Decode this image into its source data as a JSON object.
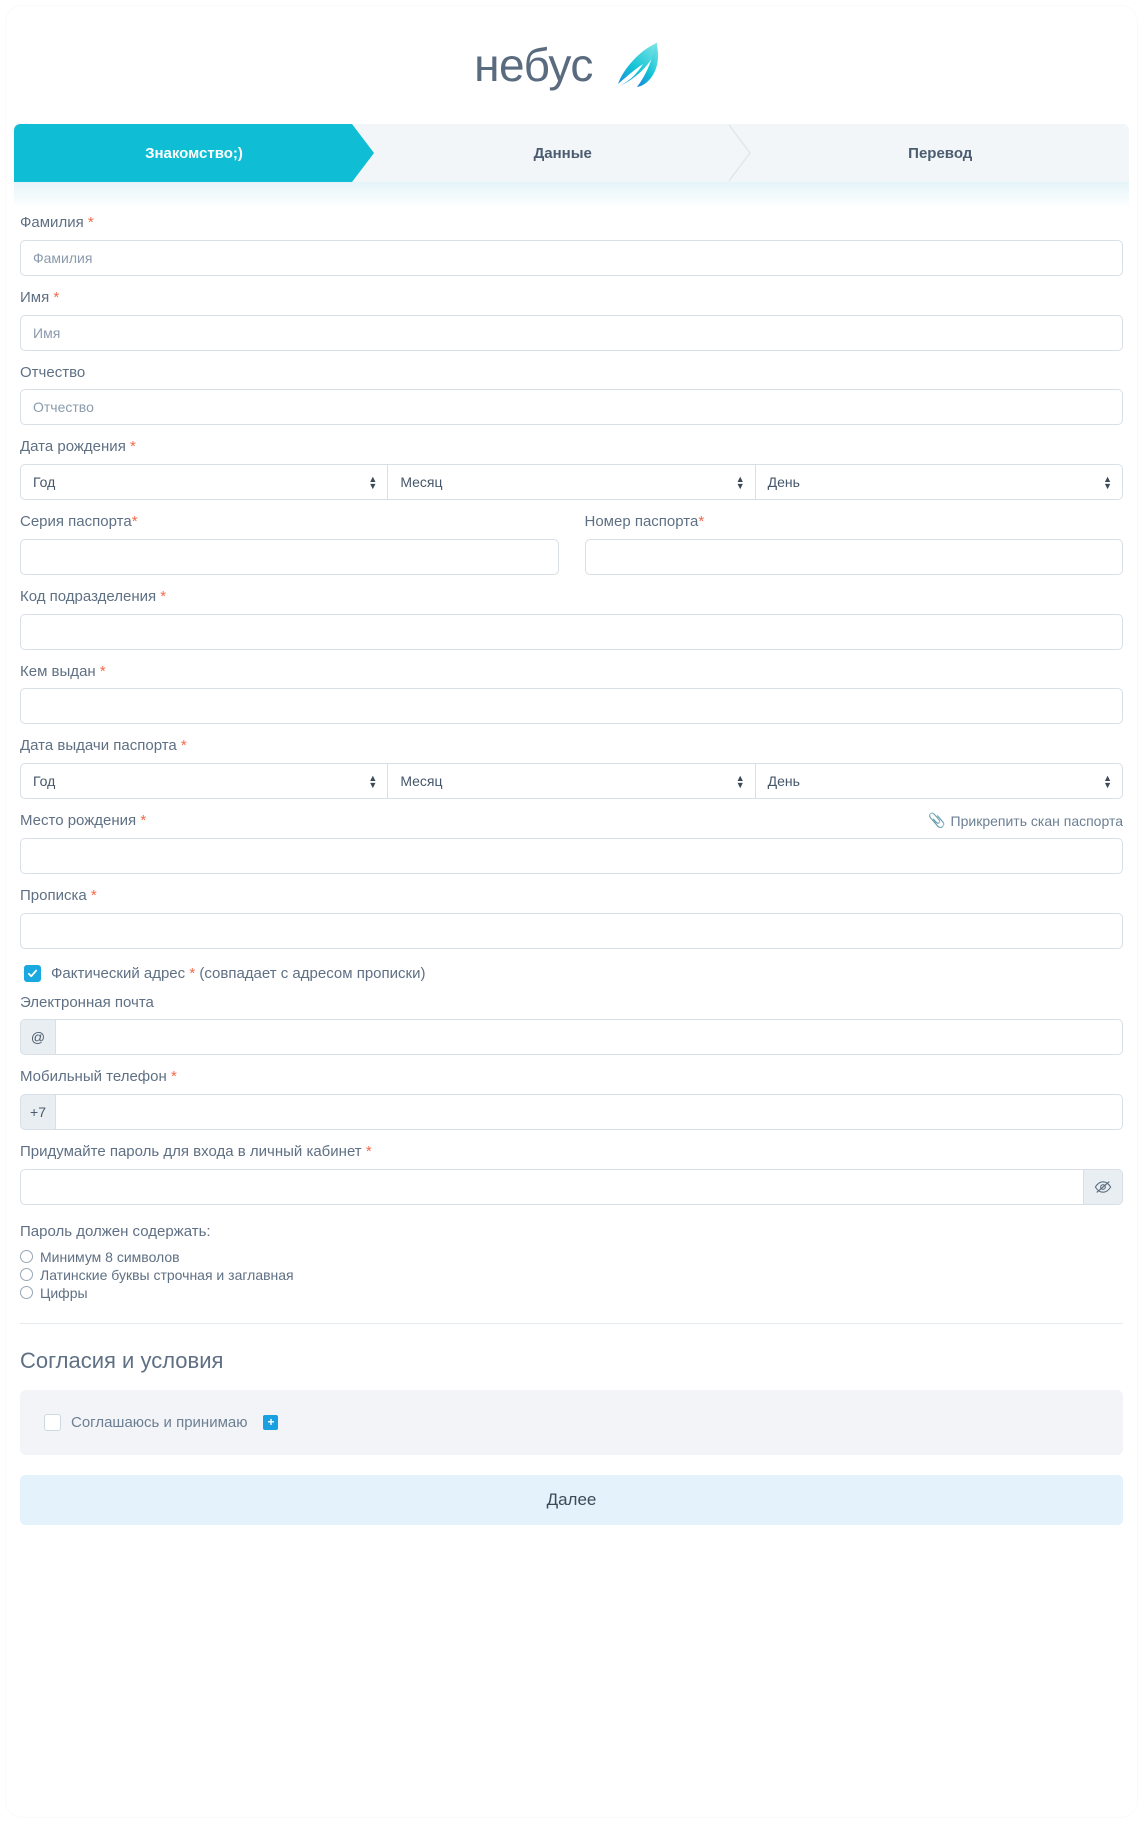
{
  "brand": {
    "name": "небус",
    "logo_icon": "swoosh-mark-icon",
    "text_color": "#5a6b80",
    "accent": "#0fbdd4"
  },
  "stepper": {
    "steps": [
      {
        "label": "Знакомство;)",
        "active": true
      },
      {
        "label": "Данные",
        "active": false
      },
      {
        "label": "Перевод",
        "active": false
      }
    ]
  },
  "form": {
    "last_name": {
      "label": "Фамилия",
      "required_mark": "*",
      "placeholder": "Фамилия",
      "value": ""
    },
    "first_name": {
      "label": "Имя",
      "required_mark": "*",
      "placeholder": "Имя",
      "value": ""
    },
    "middle_name": {
      "label": "Отчество",
      "required_mark": "",
      "placeholder": "Отчество",
      "value": ""
    },
    "birth_date": {
      "label": "Дата рождения",
      "required_mark": "*",
      "year": "Год",
      "month": "Месяц",
      "day": "День"
    },
    "passport_series": {
      "label": "Серия паспорта",
      "required_mark": "*",
      "value": ""
    },
    "passport_number": {
      "label": "Номер паспорта",
      "required_mark": "*",
      "value": ""
    },
    "division_code": {
      "label": "Код подразделения",
      "required_mark": "*",
      "value": ""
    },
    "issued_by": {
      "label": "Кем выдан",
      "required_mark": "*",
      "value": ""
    },
    "issue_date": {
      "label": "Дата выдачи паспорта",
      "required_mark": "*",
      "year": "Год",
      "month": "Месяц",
      "day": "День"
    },
    "birth_place": {
      "label": "Место рождения",
      "required_mark": "*",
      "value": ""
    },
    "attach_scan": {
      "label": "Прикрепить скан паспорта",
      "icon": "paperclip-icon"
    },
    "registration_address": {
      "label": "Прописка",
      "required_mark": "*",
      "value": ""
    },
    "actual_address": {
      "label": "Фактический адрес",
      "required_mark": "*",
      "hint": "(совпадает с адресом прописки)",
      "checked": true
    },
    "email": {
      "label": "Электронная почта",
      "required_mark": "",
      "addon": "@",
      "value": ""
    },
    "phone": {
      "label": "Мобильный телефон",
      "required_mark": "*",
      "addon": "+7",
      "value": ""
    },
    "password": {
      "label": "Придумайте пароль для входа в личный кабинет",
      "required_mark": "*",
      "value": "",
      "toggle_icon": "eye-slash-icon"
    },
    "password_rules": {
      "title": "Пароль должен содержать:",
      "items": [
        "Минимум 8 символов",
        "Латинские буквы строчная и заглавная",
        "Цифры"
      ]
    }
  },
  "agreements": {
    "title": "Согласия и условия",
    "checkbox_label": "Соглашаюсь и принимаю",
    "checked": false,
    "expand_label": "+"
  },
  "submit": {
    "label": "Далее"
  }
}
